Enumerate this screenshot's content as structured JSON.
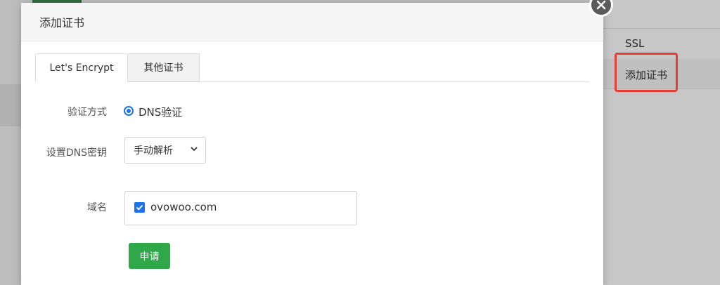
{
  "modal": {
    "title": "添加证书",
    "close_icon": "×"
  },
  "tabs": [
    {
      "label": "Let's Encrypt",
      "active": true
    },
    {
      "label": "其他证书",
      "active": false
    }
  ],
  "form": {
    "verify_method_label": "验证方式",
    "verify_method_option": "DNS验证",
    "dns_key_label": "设置DNS密钥",
    "dns_key_select": "手动解析",
    "domain_label": "域名",
    "domain_value": "ovowoo.com",
    "domain_checked": true,
    "apply_button": "申请"
  },
  "sidebar": {
    "items": [
      {
        "label": "SSL"
      },
      {
        "label": "添加证书",
        "highlighted": true
      }
    ]
  },
  "colors": {
    "primary_blue": "#1a73e8",
    "apply_green": "#2fa84a",
    "highlight_red": "#e83b33"
  }
}
